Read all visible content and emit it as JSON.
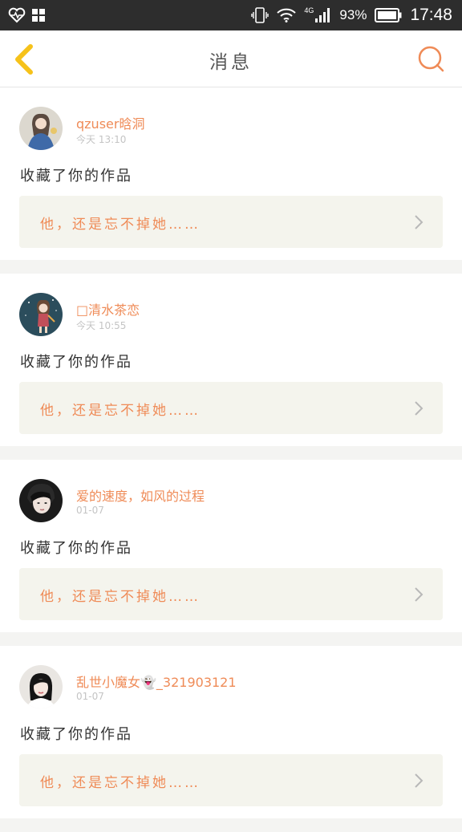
{
  "status_bar": {
    "left_icons": [
      "heart-monitor-icon",
      "apps-grid-icon"
    ],
    "right_icons": [
      "vibrate-icon",
      "wifi-icon",
      "signal-icon",
      "battery-icon"
    ],
    "network": "4G",
    "battery": "93%",
    "time": "17:48"
  },
  "header": {
    "title": "消息",
    "back_icon": "chevron-left-icon",
    "search_icon": "search-icon"
  },
  "colors": {
    "accent": "#ef8b57",
    "back_arrow": "#f6c21a",
    "card_inner": "#f4f4ed",
    "page_bg": "#f4f4f2"
  },
  "messages": [
    {
      "username": "qzuser晗洞",
      "time": "今天 13:10",
      "action": "收藏了你的作品",
      "work_title": "他，还是忘不掉她……"
    },
    {
      "username": "□清水茶恋",
      "time": "今天 10:55",
      "action": "收藏了你的作品",
      "work_title": "他，还是忘不掉她……"
    },
    {
      "username": "爱的速度，如风的过程",
      "time": "01-07",
      "action": "收藏了你的作品",
      "work_title": "他，还是忘不掉她……"
    },
    {
      "username": "乱世小魔女👻_321903121",
      "time": "01-07",
      "action": "收藏了你的作品",
      "work_title": "他，还是忘不掉她……"
    }
  ]
}
